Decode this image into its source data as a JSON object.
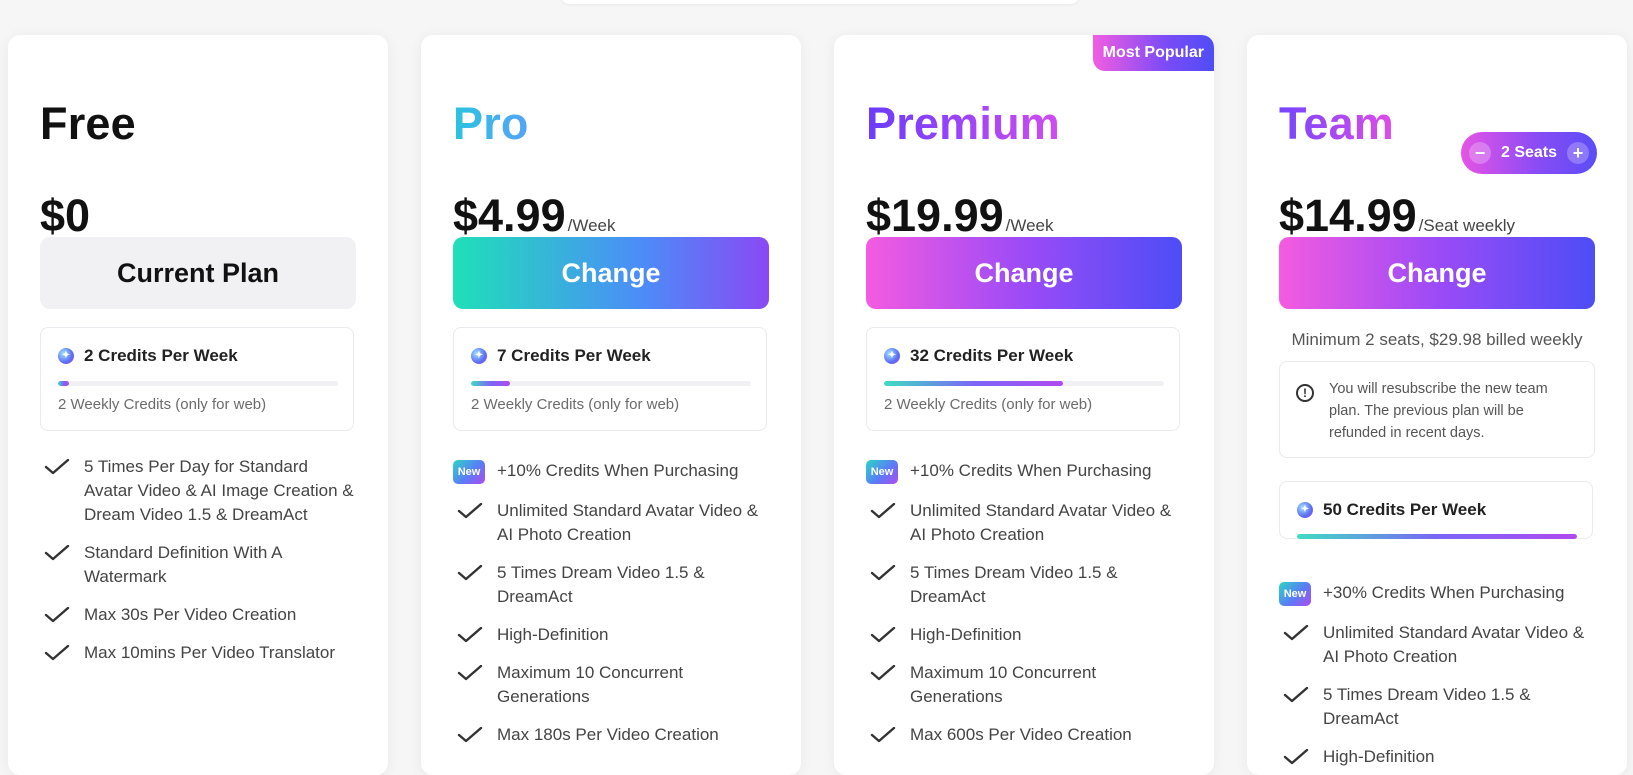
{
  "plans": [
    {
      "name": "Free",
      "price": "$0",
      "period": "",
      "button": "Current Plan",
      "credits": {
        "title": "2 Credits Per Week",
        "subtitle": "2 Weekly Credits (only for web)",
        "fill": 0.04
      },
      "features": [
        "5 Times Per Day for Standard Avatar Video & AI Image Creation & Dream Video 1.5 & DreamAct",
        "Standard Definition With A Watermark",
        "Max 30s Per Video Creation",
        "Max 10mins Per Video Translator"
      ]
    },
    {
      "name": "Pro",
      "price": "$4.99",
      "period": "/Week",
      "button": "Change",
      "credits": {
        "title": "7 Credits Per Week",
        "subtitle": "2 Weekly Credits (only for web)",
        "fill": 0.14
      },
      "new_badge": "New",
      "promo": "+10% Credits When Purchasing",
      "features": [
        "Unlimited Standard Avatar Video & AI Photo Creation",
        "5 Times Dream Video 1.5 & DreamAct",
        "High-Definition",
        "Maximum 10 Concurrent Generations",
        "Max 180s Per Video Creation"
      ]
    },
    {
      "name": "Premium",
      "badge": "Most Popular",
      "price": "$19.99",
      "period": "/Week",
      "button": "Change",
      "credits": {
        "title": "32 Credits Per Week",
        "subtitle": "2 Weekly Credits (only for web)",
        "fill": 0.64
      },
      "new_badge": "New",
      "promo": "+10% Credits When Purchasing",
      "features": [
        "Unlimited Standard Avatar Video & AI Photo Creation",
        "5 Times Dream Video 1.5 & DreamAct",
        "High-Definition",
        "Maximum 10 Concurrent Generations",
        "Max 600s Per Video Creation"
      ]
    },
    {
      "name": "Team",
      "seats": "2 Seats",
      "price": "$14.99",
      "period": "/Seat weekly",
      "button": "Change",
      "minimum": "Minimum 2 seats, $29.98 billed weekly",
      "notice": "You will resubscribe the new team plan. The previous plan will be refunded in recent days.",
      "credits": {
        "title": "50 Credits Per Week",
        "fill": 1.0
      },
      "new_badge": "New",
      "promo": "+30% Credits When Purchasing",
      "features": [
        "Unlimited Standard Avatar Video & AI Photo Creation",
        "5 Times Dream Video 1.5 & DreamAct",
        "High-Definition"
      ]
    }
  ],
  "icons": {
    "check": "check-icon",
    "coin": "credit-coin-icon",
    "info": "info-icon",
    "minus": "minus-icon",
    "plus": "plus-icon"
  },
  "colors": {
    "accent_purple": "#7b4bf6",
    "accent_pink": "#f25de2",
    "accent_teal": "#1fe0b8"
  }
}
